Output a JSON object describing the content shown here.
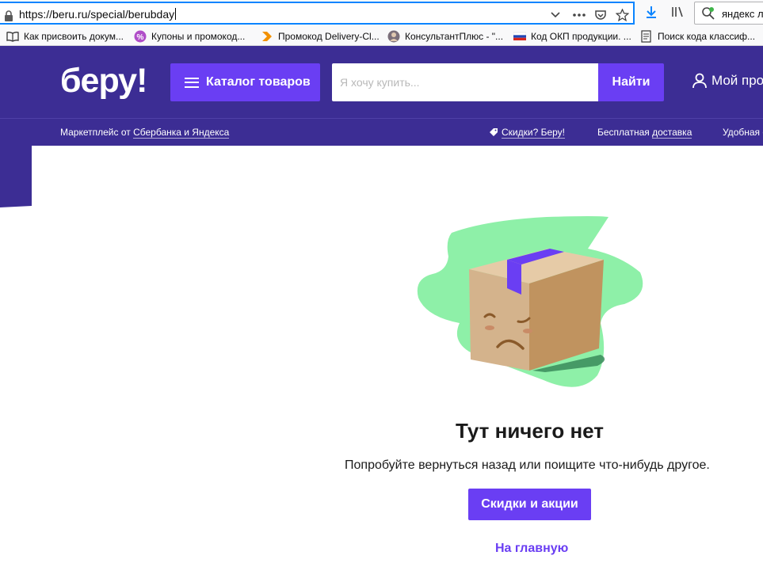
{
  "browser": {
    "url": "https://beru.ru/special/berubday",
    "search_text": "яндекс л"
  },
  "bookmarks": [
    {
      "label": "Как присвоить докум...",
      "icon": "book-icon"
    },
    {
      "label": "Купоны и промокод...",
      "icon": "percent-badge-icon"
    },
    {
      "label": "Промокод Delivery-Cl...",
      "icon": "chevron-arrow-icon"
    },
    {
      "label": "КонсультантПлюс - \"...",
      "icon": "avatar-icon"
    },
    {
      "label": "Код ОКП продукции. ...",
      "icon": "russia-flag-icon"
    },
    {
      "label": "Поиск кода классиф...",
      "icon": "document-icon"
    }
  ],
  "header": {
    "logo": "беру!",
    "catalog_label": "Каталог товаров",
    "search_placeholder": "Я хочу купить...",
    "find_label": "Найти",
    "profile_label": "Мой профиль"
  },
  "subnav": {
    "marketplace_prefix": "Маркетплейс от ",
    "marketplace_link": "Сбербанка и Яндекса",
    "discounts": "Скидки? Беру!",
    "delivery_prefix": "Бесплатная ",
    "delivery_link": "доставка",
    "convenient": "Удобная оплата"
  },
  "empty_state": {
    "title": "Тут ничего нет",
    "subtitle": "Попробуйте вернуться назад или поищите что-нибудь другое.",
    "deals_button": "Скидки и акции",
    "home_link": "На главную"
  },
  "colors": {
    "header_bg": "#3c2d94",
    "accent": "#6a3ef3",
    "blob_green": "#8ef0a8",
    "box": "#d4b38c"
  }
}
